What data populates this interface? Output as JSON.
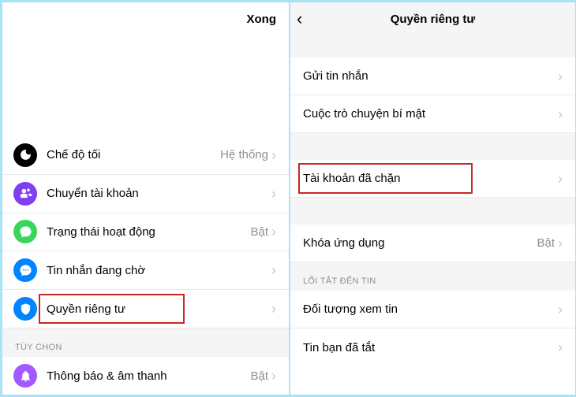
{
  "left": {
    "done": "Xong",
    "rows": {
      "dark_mode": {
        "label": "Chế độ tối",
        "value": "Hệ thống"
      },
      "switch_account": {
        "label": "Chuyển tài khoản"
      },
      "active_status": {
        "label": "Trạng thái hoạt động",
        "value": "Bật"
      },
      "msg_requests": {
        "label": "Tin nhắn đang chờ"
      },
      "privacy": {
        "label": "Quyền riêng tư"
      }
    },
    "section_options": "TÙY CHỌN",
    "notif": {
      "label": "Thông báo & âm thanh",
      "value": "Bật"
    }
  },
  "right": {
    "title": "Quyền riêng tư",
    "rows": {
      "send_msg": "Gửi tin nhắn",
      "secret_convo": "Cuộc trò chuyện bí mật",
      "blocked": "Tài khoản đã chặn",
      "app_lock": {
        "label": "Khóa ứng dụng",
        "value": "Bật"
      }
    },
    "section_story": "LỐI TẮT ĐẾN TIN",
    "story_audience": "Đối tượng xem tin",
    "story_muted": "Tin bạn đã tắt"
  }
}
